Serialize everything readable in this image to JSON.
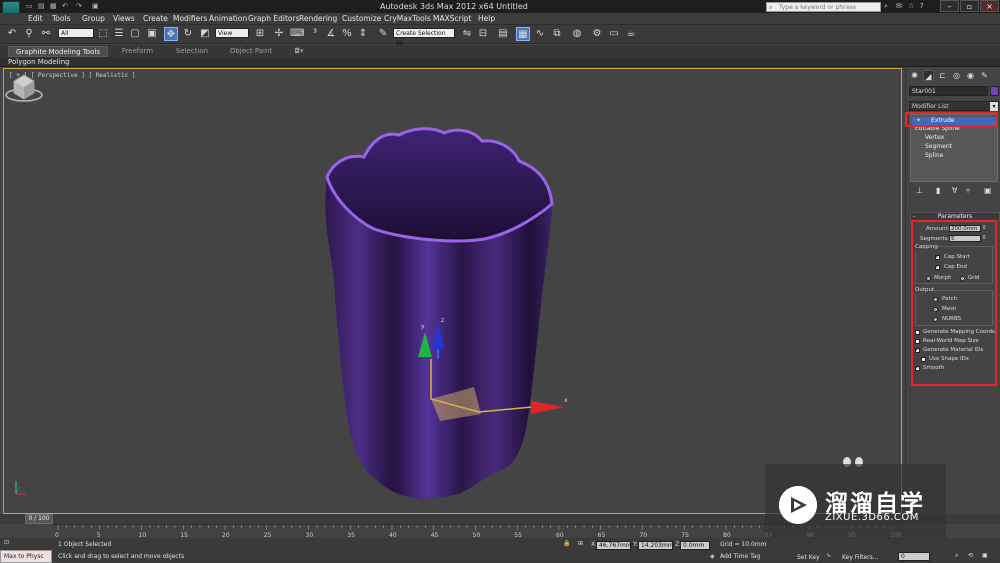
{
  "window": {
    "title": "Autodesk 3ds Max  2012 x64      Untitled",
    "search_placeholder": "Type a keyword or phrase"
  },
  "menu": [
    "Edit",
    "Tools",
    "Group",
    "Views",
    "Create",
    "Modifiers",
    "Animation",
    "Graph Editors",
    "Rendering",
    "Customize",
    "CryMaxTools",
    "MAXScript",
    "Help"
  ],
  "toolbar": {
    "filter_value": "All",
    "refcoord_value": "View",
    "selection_set_value": "Create Selection Se"
  },
  "ribbon": {
    "tabs": [
      "Graphite Modeling Tools",
      "Freeform",
      "Selection",
      "Object Paint"
    ],
    "sub_label": "Polygon Modeling"
  },
  "viewport": {
    "label": "[ + ] [ Perspective ] [ Realistic ]",
    "axis_labels": {
      "x": "x",
      "y": "y",
      "z": "z"
    }
  },
  "command_panel": {
    "object_name": "Star001",
    "object_color": "#7a3fb5",
    "modifier_list": "Modifier List",
    "stack": [
      "Extrude",
      "Editable Spline",
      "Vertex",
      "Segment",
      "Spline"
    ],
    "rollout_title": "Parameters",
    "amount_label": "Amount:",
    "amount_value": "200.0mm",
    "segments_label": "Segments:",
    "segments_value": "5",
    "capping_label": "Capping",
    "cap_start": "Cap Start",
    "cap_end": "Cap End",
    "morph": "Morph",
    "grid": "Grid",
    "output_label": "Output",
    "patch": "Patch",
    "mesh": "Mesh",
    "nurbs": "NURBS",
    "gen_mapping": "Generate Mapping Coords.",
    "real_world": "Real-World Map Size",
    "gen_matids": "Generate Material IDs",
    "use_shape_ids": "Use Shape IDs",
    "smooth": "Smooth"
  },
  "timeline": {
    "frame_label": "0 / 100",
    "ticks": [
      "0",
      "5",
      "10",
      "15",
      "20",
      "25",
      "30",
      "35",
      "40",
      "45",
      "50",
      "55",
      "60",
      "65",
      "70",
      "75",
      "80",
      "85",
      "90",
      "95",
      "100"
    ]
  },
  "status": {
    "maxscript_text": "Max to Physc",
    "selected_text": "1 Object Selected",
    "prompt_text": "Click and drag to select and move objects",
    "x_label": "X:",
    "x_value": "46.767mm",
    "y_label": "Y:",
    "y_value": "14.203mm",
    "z_label": "Z:",
    "z_value": "0.0mm",
    "grid_text": "Grid = 10.0mm",
    "add_time_tag": "Add Time Tag",
    "set_key": "Set Key",
    "key_filters": "Key Filters...",
    "frame_value": "0"
  },
  "watermark": {
    "title": "溜溜自学",
    "url": "ZIXUE.3D66.COM"
  },
  "colors": {
    "object_purple": "#4a2b7d",
    "highlight_red": "#e4262a",
    "selection_blue": "#3d69c2"
  }
}
